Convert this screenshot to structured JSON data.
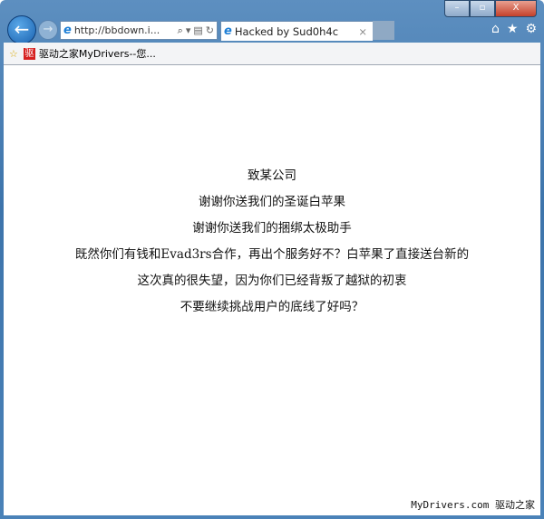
{
  "window": {
    "controls": {
      "minimize": "–",
      "maximize": "▫",
      "close": "X"
    }
  },
  "nav": {
    "back_icon": "←",
    "forward_icon": "→"
  },
  "address": {
    "url": "http://bbdown.i...",
    "search_icon": "⌕",
    "dropdown_icon": "▾",
    "compat_icon": "▤",
    "refresh_icon": "↻"
  },
  "tab": {
    "title": "Hacked by Sud0h4c",
    "close": "×"
  },
  "toolbar": {
    "home": "⌂",
    "favorites": "★",
    "settings": "⚙"
  },
  "favbar": {
    "add_icon": "☆",
    "logo": "驱",
    "item": "驱动之家MyDrivers--您..."
  },
  "content": {
    "lines": [
      "致某公司",
      "谢谢你送我们的圣诞白苹果",
      "谢谢你送我们的捆绑太极助手",
      "既然你们有钱和Evad3rs合作，再出个服务好不？白苹果了直接送台新的",
      "这次真的很失望，因为你们已经背叛了越狱的初衷",
      "不要继续挑战用户的底线了好吗？"
    ]
  },
  "watermark": "MyDrivers.com 驱动之家"
}
